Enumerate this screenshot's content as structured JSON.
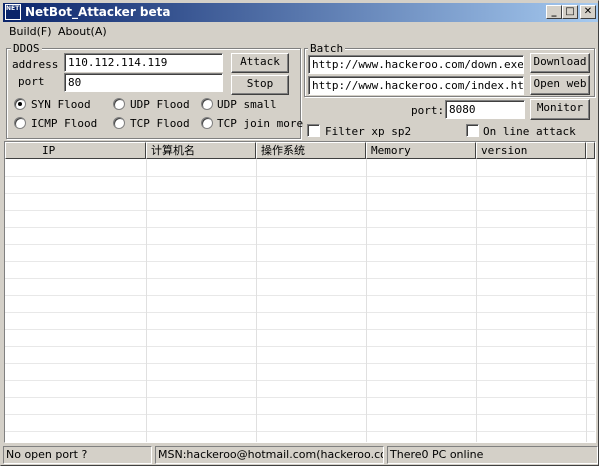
{
  "window": {
    "title": "NetBot_Attacker beta",
    "icon_text": "NETBOT",
    "minimize": "0",
    "maximize": "1",
    "close": "r"
  },
  "menu": [
    "Build(F)",
    "About(A)"
  ],
  "ddos": {
    "label": "DDOS",
    "address_label": "address",
    "address_value": "110.112.114.119",
    "port_label": "port",
    "port_value": "80",
    "attack_button": "Attack",
    "stop_button": "Stop",
    "modes": [
      {
        "label": "SYN Flood",
        "selected": true
      },
      {
        "label": "UDP Flood",
        "selected": false
      },
      {
        "label": "UDP small",
        "selected": false
      },
      {
        "label": "ICMP Flood",
        "selected": false
      },
      {
        "label": "TCP Flood",
        "selected": false
      },
      {
        "label": "TCP join more",
        "selected": false
      }
    ]
  },
  "batch": {
    "label": "Batch",
    "url1": "http://www.hackeroo.com/down.exe",
    "url2": "http://www.hackeroo.com/index.htm",
    "download_button": "Download",
    "open_web_button": "Open web"
  },
  "monitor": {
    "port_label": "port:",
    "port_value": "8080",
    "monitor_button": "Monitor",
    "filter_label": "Filter xp sp2",
    "online_label": "On line attack"
  },
  "table": {
    "columns": [
      "IP",
      "计算机名",
      "操作系统",
      "Memory",
      "version"
    ],
    "rows": []
  },
  "status": {
    "pane1": "No open port     ?",
    "pane2": "MSN:hackeroo@hotmail.com(hackeroo.com)",
    "pane3": "There0 PC online"
  }
}
